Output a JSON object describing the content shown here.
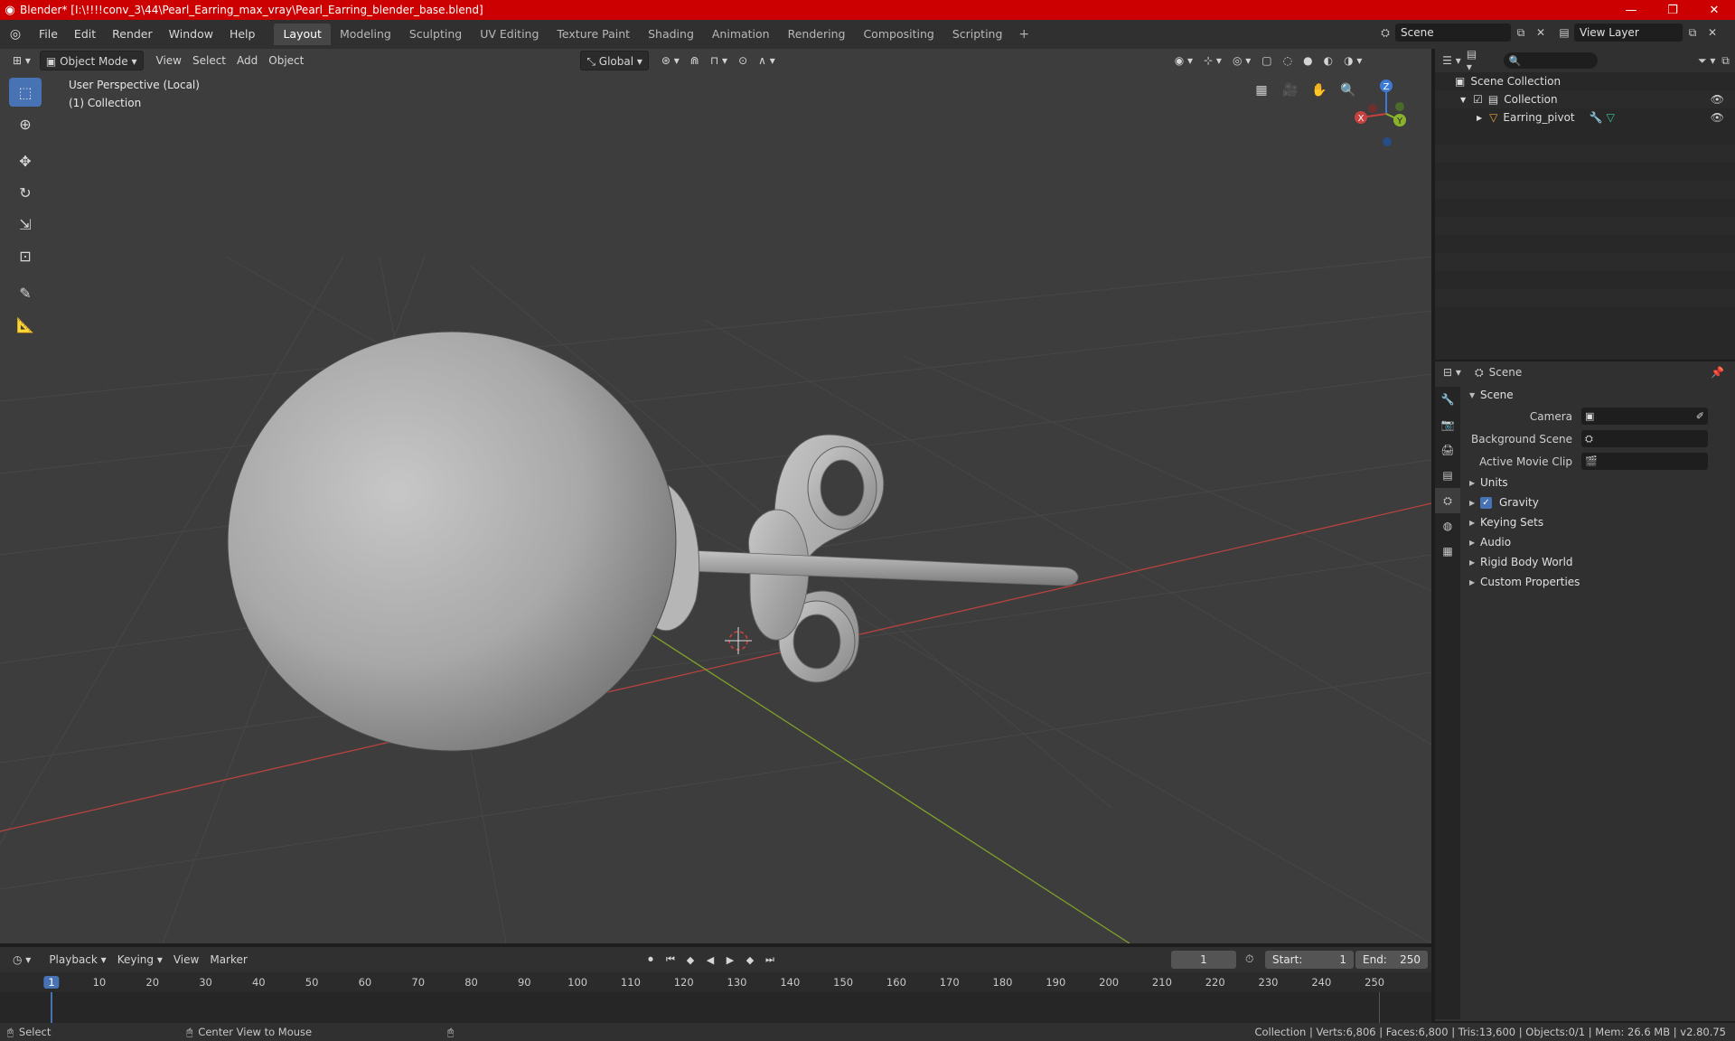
{
  "window": {
    "title": "Blender* [I:\\!!!!conv_3\\44\\Pearl_Earring_max_vray\\Pearl_Earring_blender_base.blend]",
    "minimize": "—",
    "maximize": "❐",
    "close": "✕"
  },
  "menu": {
    "file": "File",
    "edit": "Edit",
    "render": "Render",
    "window": "Window",
    "help": "Help"
  },
  "workspaces": [
    {
      "label": "Layout",
      "active": true
    },
    {
      "label": "Modeling"
    },
    {
      "label": "Sculpting"
    },
    {
      "label": "UV Editing"
    },
    {
      "label": "Texture Paint"
    },
    {
      "label": "Shading"
    },
    {
      "label": "Animation"
    },
    {
      "label": "Rendering"
    },
    {
      "label": "Compositing"
    },
    {
      "label": "Scripting"
    }
  ],
  "scene_selector": {
    "scene": "Scene",
    "view_layer": "View Layer"
  },
  "viewport": {
    "mode": "Object Mode",
    "view": "View",
    "select": "Select",
    "add": "Add",
    "object": "Object",
    "orientation": "Global",
    "info_line1": "User Perspective (Local)",
    "info_line2": "(1) Collection",
    "gizmo": {
      "x": "X",
      "y": "Y",
      "z": "Z"
    }
  },
  "outliner": {
    "scene_collection": "Scene Collection",
    "collection": "Collection",
    "object": "Earring_pivot"
  },
  "properties": {
    "header": "Scene",
    "panel_scene": "Scene",
    "camera_label": "Camera",
    "background_scene_label": "Background Scene",
    "active_movie_clip_label": "Active Movie Clip",
    "panels": {
      "units": "Units",
      "gravity": "Gravity",
      "keying_sets": "Keying Sets",
      "audio": "Audio",
      "rigid_body_world": "Rigid Body World",
      "custom_properties": "Custom Properties"
    }
  },
  "timeline": {
    "playback": "Playback",
    "keying": "Keying",
    "view": "View",
    "marker": "Marker",
    "current_frame": "1",
    "start_label": "Start:",
    "start": "1",
    "end_label": "End:",
    "end": "250",
    "ruler_labels": [
      "1",
      "10",
      "20",
      "30",
      "40",
      "50",
      "60",
      "70",
      "80",
      "90",
      "100",
      "110",
      "120",
      "130",
      "140",
      "150",
      "160",
      "170",
      "180",
      "190",
      "200",
      "210",
      "220",
      "230",
      "240",
      "250"
    ]
  },
  "statusbar": {
    "select": "Select",
    "center_view": "Center View to Mouse",
    "stats": "Collection | Verts:6,806 | Faces:6,800 | Tris:13,600 | Objects:0/1 | Mem: 26.6 MB | v2.80.75"
  },
  "colors": {
    "accent": "#4772b3",
    "titlebar": "#cc0000",
    "axis_x": "#c8413f",
    "axis_y": "#8ab32c",
    "axis_z": "#3d7ad6"
  }
}
